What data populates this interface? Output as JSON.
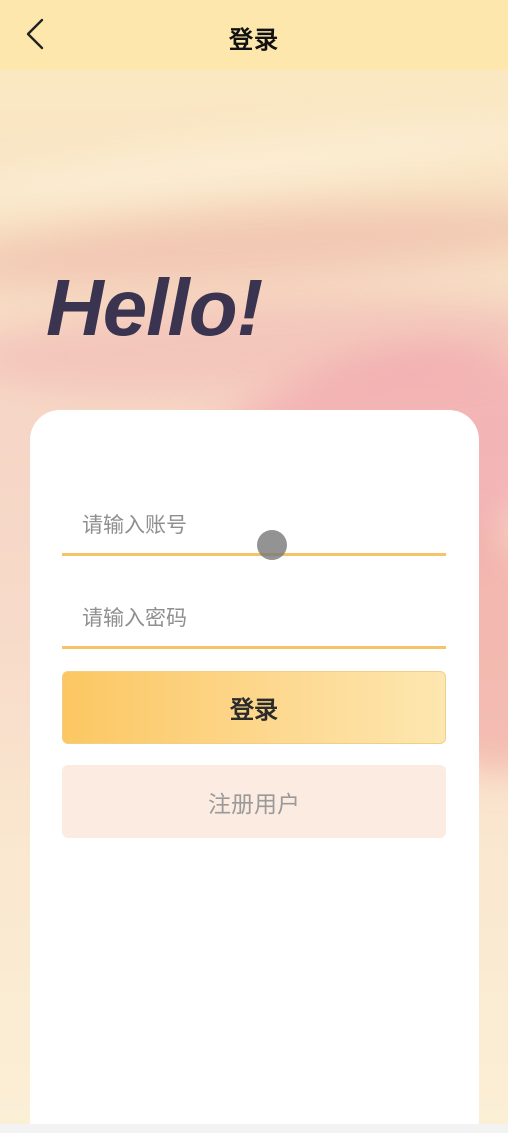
{
  "header": {
    "title": "登录",
    "back_icon": "chevron-left-icon"
  },
  "hero": {
    "greeting": "Hello!"
  },
  "form": {
    "account": {
      "placeholder": "请输入账号",
      "value": ""
    },
    "password": {
      "placeholder": "请输入密码",
      "value": ""
    },
    "login_label": "登录",
    "register_label": "注册用户"
  },
  "colors": {
    "nav_background": "#fde7ad",
    "accent": "#f6c468",
    "title_text": "#3a3450",
    "register_background": "#fcebe1"
  }
}
